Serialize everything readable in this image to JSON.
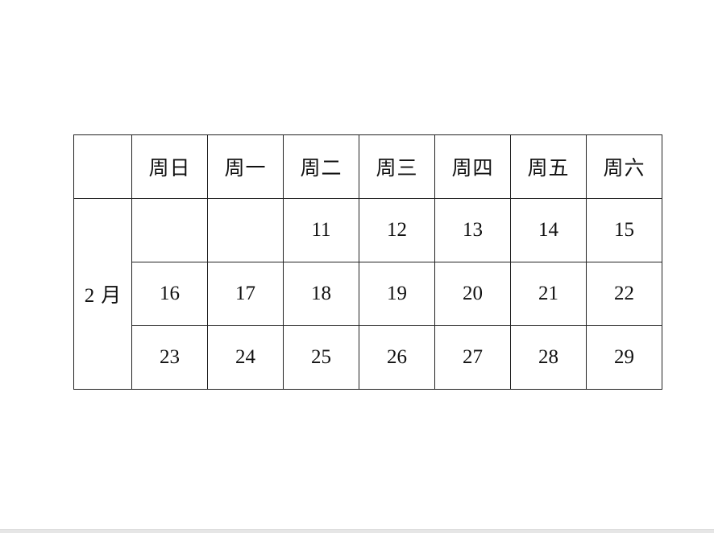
{
  "calendar": {
    "corner": "",
    "weekdays": [
      "周日",
      "周一",
      "周二",
      "周三",
      "周四",
      "周五",
      "周六"
    ],
    "month": {
      "number": "2",
      "unit": "月"
    },
    "weeks": [
      [
        "",
        "",
        "11",
        "12",
        "13",
        "14",
        "15"
      ],
      [
        "16",
        "17",
        "18",
        "19",
        "20",
        "21",
        "22"
      ],
      [
        "23",
        "24",
        "25",
        "26",
        "27",
        "28",
        "29"
      ]
    ]
  }
}
